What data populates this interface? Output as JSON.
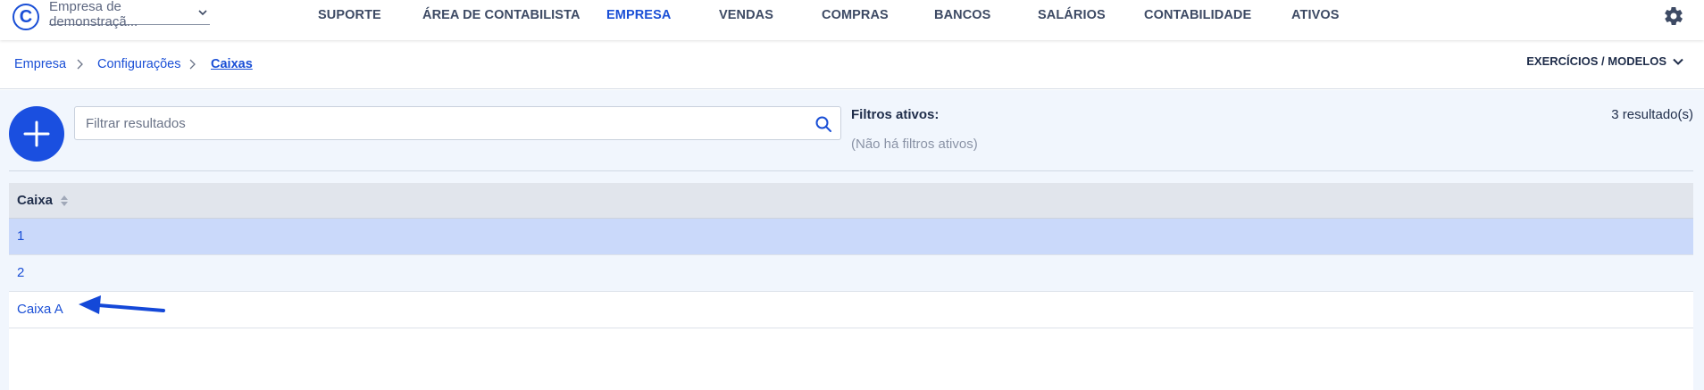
{
  "app": {
    "logo_letter": "C",
    "company_selector": "Empresa de demonstraçã..."
  },
  "nav": {
    "items": [
      {
        "label": "SUPORTE"
      },
      {
        "label": "ÁREA DE CONTABILISTA"
      },
      {
        "label": "EMPRESA"
      },
      {
        "label": "VENDAS"
      },
      {
        "label": "COMPRAS"
      },
      {
        "label": "BANCOS"
      },
      {
        "label": "SALÁRIOS"
      },
      {
        "label": "CONTABILIDADE"
      },
      {
        "label": "ATIVOS"
      }
    ],
    "active": "EMPRESA"
  },
  "breadcrumb": {
    "items": [
      {
        "label": "Empresa"
      },
      {
        "label": "Configurações"
      },
      {
        "label": "Caixas"
      }
    ]
  },
  "exercises_menu": {
    "label": "EXERCÍCIOS / MODELOS"
  },
  "search": {
    "placeholder": "Filtrar resultados",
    "value": ""
  },
  "filters": {
    "title": "Filtros ativos:",
    "none_text": "(Não há filtros ativos)"
  },
  "results": {
    "count_text": "3 resultado(s)"
  },
  "table": {
    "column": "Caixa",
    "rows": [
      {
        "caixa": "1"
      },
      {
        "caixa": "2"
      },
      {
        "caixa": "Caixa A"
      }
    ]
  },
  "colors": {
    "accent": "#1a4fd6",
    "add_button": "#1a4fe0",
    "selected_row": "#cad9fa",
    "page_bg": "#f1f6fd"
  }
}
